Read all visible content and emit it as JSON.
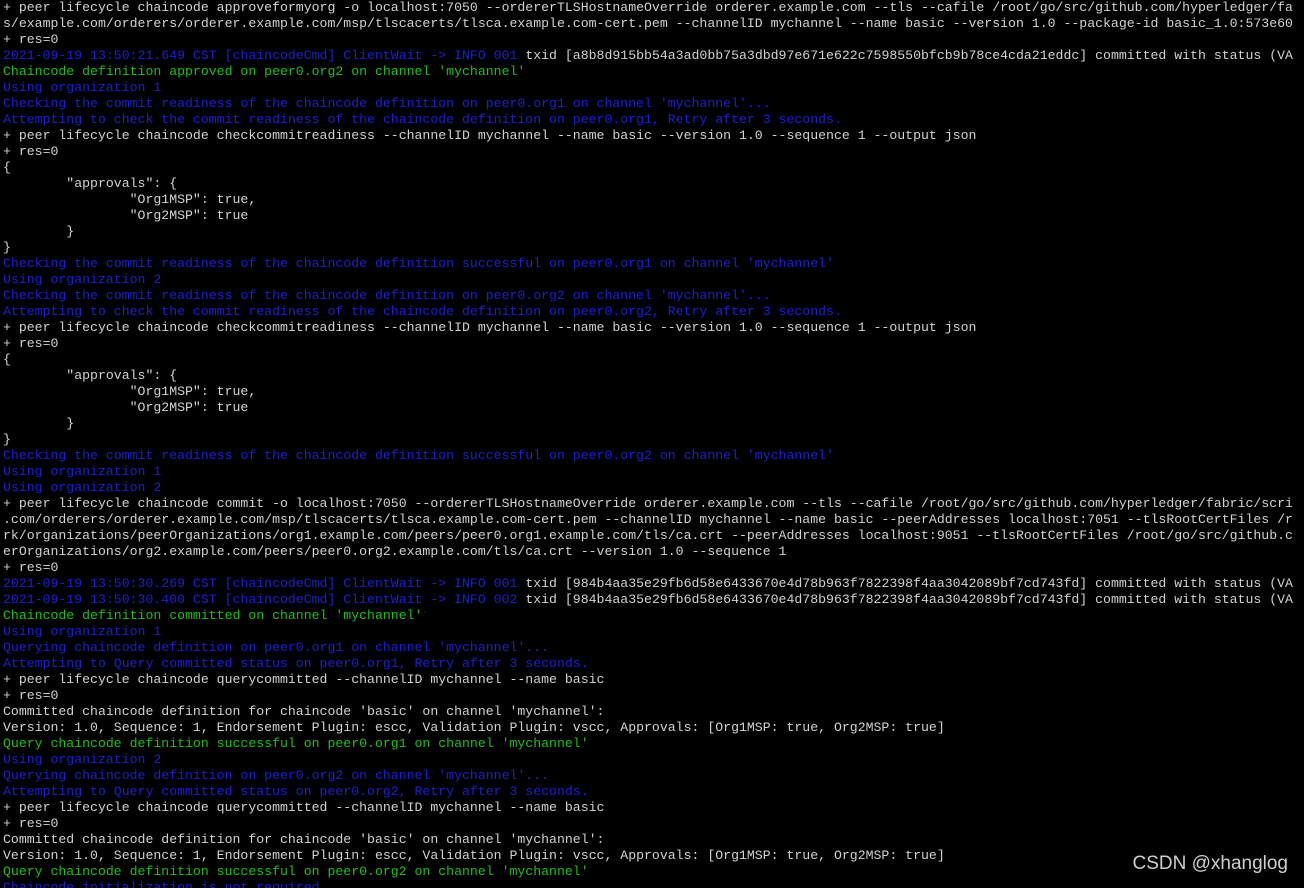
{
  "terminal": {
    "lines": [
      {
        "color": "white",
        "text": "+ peer lifecycle chaincode approveformyorg -o localhost:7050 --ordererTLSHostnameOverride orderer.example.com --tls --cafile /root/go/src/github.com/hyperledger/fa"
      },
      {
        "color": "white",
        "text": "s/example.com/orderers/orderer.example.com/msp/tlscacerts/tlsca.example.com-cert.pem --channelID mychannel --name basic --version 1.0 --package-id basic_1.0:573e60"
      },
      {
        "color": "white",
        "text": "+ res=0"
      },
      {
        "color": "blue",
        "text": "2021-09-19 13:50:21.649 CST [chaincodeCmd] ClientWait -> INFO 001",
        "suffix": " txid [a8b8d915bb54a3ad0bb75a3dbd97e671e622c7598550bfcb9b78ce4cda21eddc] committed with status (VA"
      },
      {
        "color": "green",
        "text": "Chaincode definition approved on peer0.org2 on channel 'mychannel'"
      },
      {
        "color": "blue",
        "text": "Using organization 1"
      },
      {
        "color": "blue",
        "text": "Checking the commit readiness of the chaincode definition on peer0.org1 on channel 'mychannel'..."
      },
      {
        "color": "blue",
        "text": "Attempting to check the commit readiness of the chaincode definition on peer0.org1, Retry after 3 seconds."
      },
      {
        "color": "white",
        "text": "+ peer lifecycle chaincode checkcommitreadiness --channelID mychannel --name basic --version 1.0 --sequence 1 --output json"
      },
      {
        "color": "white",
        "text": "+ res=0"
      },
      {
        "color": "white",
        "text": "{"
      },
      {
        "color": "white",
        "text": "        \"approvals\": {"
      },
      {
        "color": "white",
        "text": "                \"Org1MSP\": true,"
      },
      {
        "color": "white",
        "text": "                \"Org2MSP\": true"
      },
      {
        "color": "white",
        "text": "        }"
      },
      {
        "color": "white",
        "text": "}"
      },
      {
        "color": "blue",
        "text": "Checking the commit readiness of the chaincode definition successful on peer0.org1 on channel 'mychannel'"
      },
      {
        "color": "blue",
        "text": "Using organization 2"
      },
      {
        "color": "blue",
        "text": "Checking the commit readiness of the chaincode definition on peer0.org2 on channel 'mychannel'..."
      },
      {
        "color": "blue",
        "text": "Attempting to check the commit readiness of the chaincode definition on peer0.org2, Retry after 3 seconds."
      },
      {
        "color": "white",
        "text": "+ peer lifecycle chaincode checkcommitreadiness --channelID mychannel --name basic --version 1.0 --sequence 1 --output json"
      },
      {
        "color": "white",
        "text": "+ res=0"
      },
      {
        "color": "white",
        "text": "{"
      },
      {
        "color": "white",
        "text": "        \"approvals\": {"
      },
      {
        "color": "white",
        "text": "                \"Org1MSP\": true,"
      },
      {
        "color": "white",
        "text": "                \"Org2MSP\": true"
      },
      {
        "color": "white",
        "text": "        }"
      },
      {
        "color": "white",
        "text": "}"
      },
      {
        "color": "blue",
        "text": "Checking the commit readiness of the chaincode definition successful on peer0.org2 on channel 'mychannel'"
      },
      {
        "color": "blue",
        "text": "Using organization 1"
      },
      {
        "color": "blue",
        "text": "Using organization 2"
      },
      {
        "color": "white",
        "text": "+ peer lifecycle chaincode commit -o localhost:7050 --ordererTLSHostnameOverride orderer.example.com --tls --cafile /root/go/src/github.com/hyperledger/fabric/scri"
      },
      {
        "color": "white",
        "text": ".com/orderers/orderer.example.com/msp/tlscacerts/tlsca.example.com-cert.pem --channelID mychannel --name basic --peerAddresses localhost:7051 --tlsRootCertFiles /r"
      },
      {
        "color": "white",
        "text": "rk/organizations/peerOrganizations/org1.example.com/peers/peer0.org1.example.com/tls/ca.crt --peerAddresses localhost:9051 --tlsRootCertFiles /root/go/src/github.c"
      },
      {
        "color": "white",
        "text": "erOrganizations/org2.example.com/peers/peer0.org2.example.com/tls/ca.crt --version 1.0 --sequence 1"
      },
      {
        "color": "white",
        "text": "+ res=0"
      },
      {
        "color": "blue",
        "text": "2021-09-19 13:50:30.269 CST [chaincodeCmd] ClientWait -> INFO 001",
        "suffix": " txid [984b4aa35e29fb6d58e6433670e4d78b963f7822398f4aa3042089bf7cd743fd] committed with status (VA"
      },
      {
        "color": "blue",
        "text": "2021-09-19 13:50:30.400 CST [chaincodeCmd] ClientWait -> INFO 002",
        "suffix": " txid [984b4aa35e29fb6d58e6433670e4d78b963f7822398f4aa3042089bf7cd743fd] committed with status (VA"
      },
      {
        "color": "green",
        "text": "Chaincode definition committed on channel 'mychannel'"
      },
      {
        "color": "blue",
        "text": "Using organization 1"
      },
      {
        "color": "blue",
        "text": "Querying chaincode definition on peer0.org1 on channel 'mychannel'..."
      },
      {
        "color": "blue",
        "text": "Attempting to Query committed status on peer0.org1, Retry after 3 seconds."
      },
      {
        "color": "white",
        "text": "+ peer lifecycle chaincode querycommitted --channelID mychannel --name basic"
      },
      {
        "color": "white",
        "text": "+ res=0"
      },
      {
        "color": "white",
        "text": "Committed chaincode definition for chaincode 'basic' on channel 'mychannel':"
      },
      {
        "color": "white",
        "text": "Version: 1.0, Sequence: 1, Endorsement Plugin: escc, Validation Plugin: vscc, Approvals: [Org1MSP: true, Org2MSP: true]"
      },
      {
        "color": "green",
        "text": "Query chaincode definition successful on peer0.org1 on channel 'mychannel'"
      },
      {
        "color": "blue",
        "text": "Using organization 2"
      },
      {
        "color": "blue",
        "text": "Querying chaincode definition on peer0.org2 on channel 'mychannel'..."
      },
      {
        "color": "blue",
        "text": "Attempting to Query committed status on peer0.org2, Retry after 3 seconds."
      },
      {
        "color": "white",
        "text": "+ peer lifecycle chaincode querycommitted --channelID mychannel --name basic"
      },
      {
        "color": "white",
        "text": "+ res=0"
      },
      {
        "color": "white",
        "text": "Committed chaincode definition for chaincode 'basic' on channel 'mychannel':"
      },
      {
        "color": "white",
        "text": "Version: 1.0, Sequence: 1, Endorsement Plugin: escc, Validation Plugin: vscc, Approvals: [Org1MSP: true, Org2MSP: true]"
      },
      {
        "color": "green",
        "text": "Query chaincode definition successful on peer0.org2 on channel 'mychannel'"
      },
      {
        "color": "blue",
        "text": "Chaincode initialization is not required"
      }
    ]
  },
  "watermark": {
    "text": "CSDN @xhanglog"
  },
  "colors": {
    "background": "#000000",
    "white": "#d2d2d2",
    "blue": "#1f1fd4",
    "green": "#19c219"
  }
}
